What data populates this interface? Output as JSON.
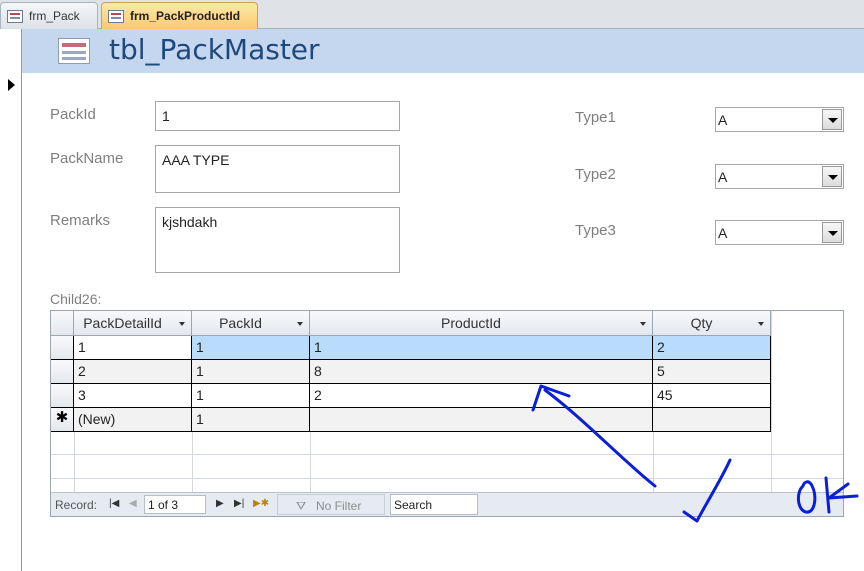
{
  "tabs": [
    {
      "label": "frm_Pack"
    },
    {
      "label": "frm_PackProductId"
    }
  ],
  "form": {
    "title": "tbl_PackMaster",
    "fields": {
      "packid": {
        "label": "PackId",
        "value": "1"
      },
      "packname": {
        "label": "PackName",
        "value": "AAA TYPE"
      },
      "remarks": {
        "label": "Remarks",
        "value": "kjshdakh"
      },
      "type1": {
        "label": "Type1",
        "value": "A"
      },
      "type2": {
        "label": "Type2",
        "value": "A"
      },
      "type3": {
        "label": "Type3",
        "value": "A"
      }
    }
  },
  "subform": {
    "label": "Child26:",
    "columns": [
      "PackDetailId",
      "PackId",
      "ProductId",
      "Qty"
    ],
    "rows": [
      [
        "1",
        "1",
        "1",
        "2"
      ],
      [
        "2",
        "1",
        "8",
        "5"
      ],
      [
        "3",
        "1",
        "2",
        "45"
      ]
    ],
    "new_row": {
      "marker": "✱",
      "detail": "(New)",
      "packid": "1"
    },
    "navigation": {
      "record_label": "Record:",
      "record_value": "1 of 3",
      "filter_label": "No Filter",
      "search_value": "Search"
    }
  },
  "colors": {
    "header_band": "#c5d7ef",
    "title": "#1f497d",
    "active_tab": "#f9c970",
    "selected_row": "#b9dcfd",
    "ink": "#0a1fd6"
  },
  "annotations": {
    "handwriting_text": "OK"
  }
}
